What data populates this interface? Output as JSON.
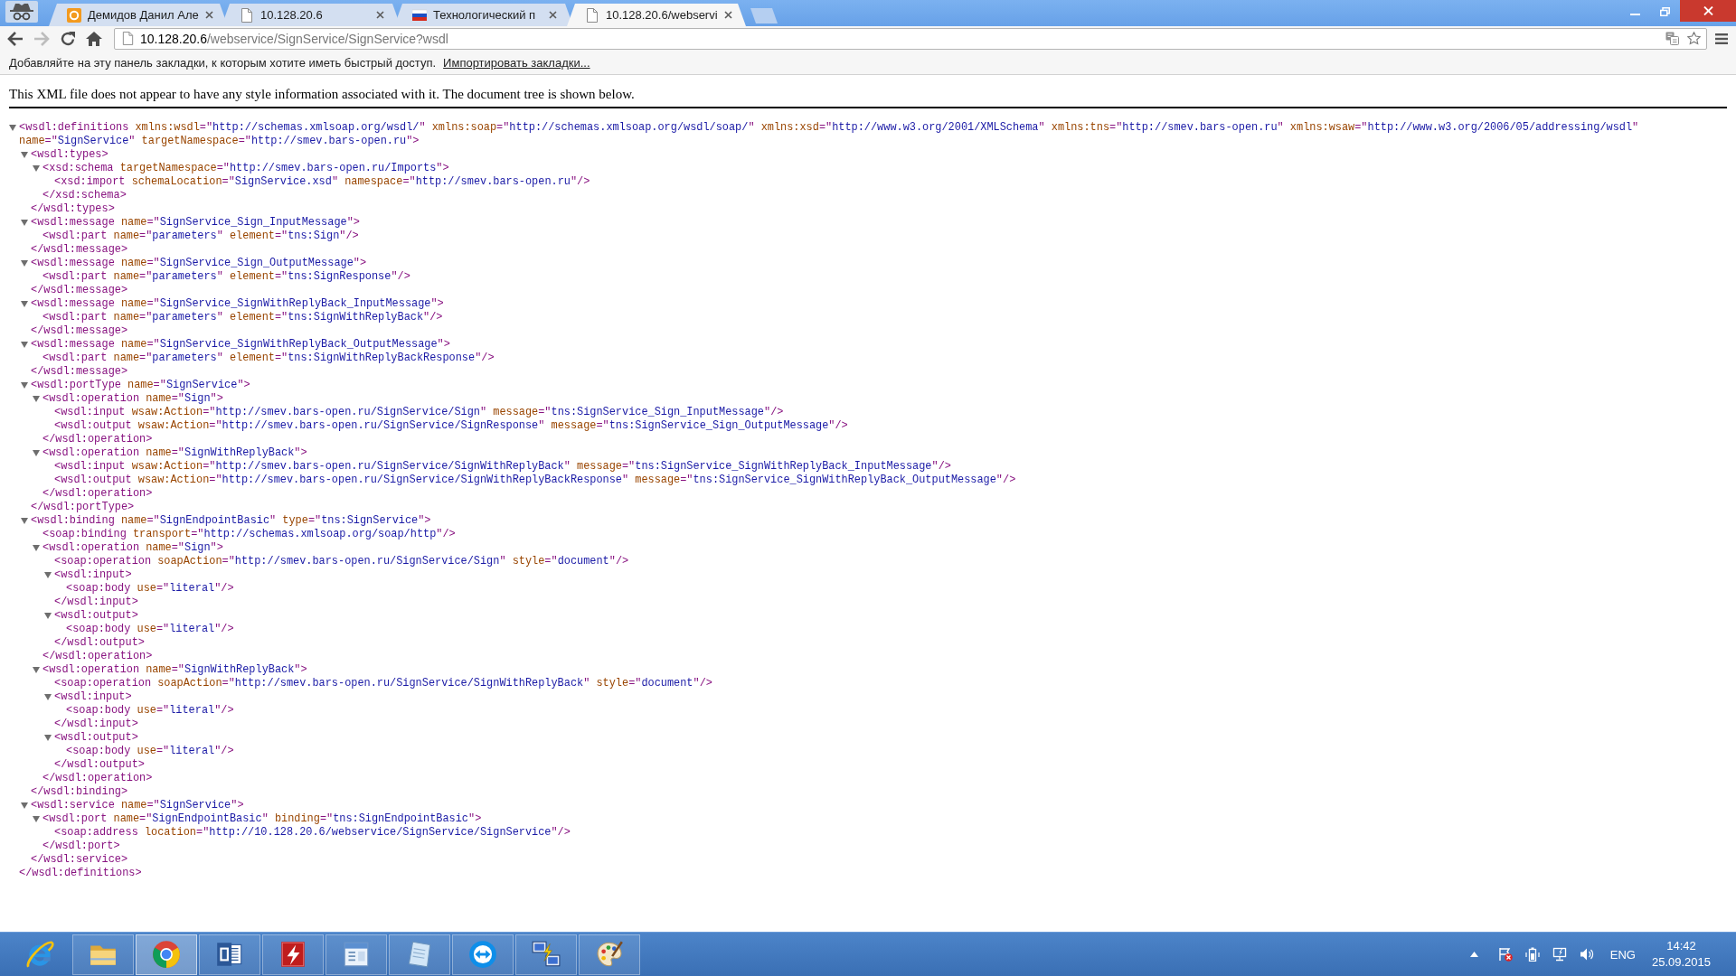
{
  "browser": {
    "tabs": [
      {
        "title": "Демидов Данил Але",
        "kind": "tile",
        "selected": false
      },
      {
        "title": "10.128.20.6",
        "kind": "page",
        "selected": false
      },
      {
        "title": "Технологический п",
        "kind": "flag",
        "selected": false
      },
      {
        "title": "10.128.20.6/webservi",
        "kind": "page",
        "selected": true
      }
    ]
  },
  "toolbar": {
    "buttons": [
      {
        "kind": "back",
        "disabled": false
      },
      {
        "kind": "forward",
        "disabled": true
      },
      {
        "kind": "reload",
        "disabled": false
      },
      {
        "kind": "home",
        "disabled": false
      }
    ],
    "address": {
      "host": "10.128.20.6",
      "path": "/webservice/SignService/SignService?wsdl"
    }
  },
  "bookmarks_bar": {
    "hint": "Добавляйте на эту панель закладки, к которым хотите иметь быстрый доступ.",
    "link": "Импортировать закладки..."
  },
  "notice": "This XML file does not appear to have any style information associated with it. The document tree is shown below.",
  "xml": {
    "tag": "<wsdl:definitions",
    "attrs": [
      "xmlns:wsdl=\"http://schemas.xmlsoap.org/wsdl/\"",
      "xmlns:soap=\"http://schemas.xmlsoap.org/wsdl/soap/\"",
      "xmlns:xsd=\"http://www.w3.org/2001/XMLSchema\"",
      "xmlns:tns=\"http://smev.bars-open.ru\"",
      "xmlns:wsaw=\"http://www.w3.org/2006/05/addressing/wsdl\"",
      "name=\"SignService\"",
      "targetNamespace=\"http://smev.bars-open.ru\""
    ],
    "end": ">",
    "expanded": true,
    "children": [
      {
        "tag": "<wsdl:types",
        "end": ">",
        "expanded": true,
        "children": [
          {
            "tag": "<xsd:schema",
            "attrs": [
              "targetNamespace=\"http://smev.bars-open.ru/Imports\""
            ],
            "end": ">",
            "expanded": true,
            "children": [
              {
                "tag": "<xsd:import",
                "attrs": [
                  "schemaLocation=\"SignService.xsd\"",
                  "namespace=\"http://smev.bars-open.ru\""
                ],
                "end": "/>"
              }
            ],
            "close": "</xsd:schema>"
          }
        ],
        "close": "</wsdl:types>"
      },
      {
        "tag": "<wsdl:message",
        "attrs": [
          "name=\"SignService_Sign_InputMessage\""
        ],
        "end": ">",
        "expanded": true,
        "children": [
          {
            "tag": "<wsdl:part",
            "attrs": [
              "name=\"parameters\"",
              "element=\"tns:Sign\""
            ],
            "end": "/>"
          }
        ],
        "close": "</wsdl:message>"
      },
      {
        "tag": "<wsdl:message",
        "attrs": [
          "name=\"SignService_Sign_OutputMessage\""
        ],
        "end": ">",
        "expanded": true,
        "children": [
          {
            "tag": "<wsdl:part",
            "attrs": [
              "name=\"parameters\"",
              "element=\"tns:SignResponse\""
            ],
            "end": "/>"
          }
        ],
        "close": "</wsdl:message>"
      },
      {
        "tag": "<wsdl:message",
        "attrs": [
          "name=\"SignService_SignWithReplyBack_InputMessage\""
        ],
        "end": ">",
        "expanded": true,
        "children": [
          {
            "tag": "<wsdl:part",
            "attrs": [
              "name=\"parameters\"",
              "element=\"tns:SignWithReplyBack\""
            ],
            "end": "/>"
          }
        ],
        "close": "</wsdl:message>"
      },
      {
        "tag": "<wsdl:message",
        "attrs": [
          "name=\"SignService_SignWithReplyBack_OutputMessage\""
        ],
        "end": ">",
        "expanded": true,
        "children": [
          {
            "tag": "<wsdl:part",
            "attrs": [
              "name=\"parameters\"",
              "element=\"tns:SignWithReplyBackResponse\""
            ],
            "end": "/>"
          }
        ],
        "close": "</wsdl:message>"
      },
      {
        "tag": "<wsdl:portType",
        "attrs": [
          "name=\"SignService\""
        ],
        "end": ">",
        "expanded": true,
        "children": [
          {
            "tag": "<wsdl:operation",
            "attrs": [
              "name=\"Sign\""
            ],
            "end": ">",
            "expanded": true,
            "children": [
              {
                "tag": "<wsdl:input",
                "attrs": [
                  "wsaw:Action=\"http://smev.bars-open.ru/SignService/Sign\"",
                  "message=\"tns:SignService_Sign_InputMessage\""
                ],
                "end": "/>"
              },
              {
                "tag": "<wsdl:output",
                "attrs": [
                  "wsaw:Action=\"http://smev.bars-open.ru/SignService/SignResponse\"",
                  "message=\"tns:SignService_Sign_OutputMessage\""
                ],
                "end": "/>"
              }
            ],
            "close": "</wsdl:operation>"
          },
          {
            "tag": "<wsdl:operation",
            "attrs": [
              "name=\"SignWithReplyBack\""
            ],
            "end": ">",
            "expanded": true,
            "children": [
              {
                "tag": "<wsdl:input",
                "attrs": [
                  "wsaw:Action=\"http://smev.bars-open.ru/SignService/SignWithReplyBack\"",
                  "message=\"tns:SignService_SignWithReplyBack_InputMessage\""
                ],
                "end": "/>"
              },
              {
                "tag": "<wsdl:output",
                "attrs": [
                  "wsaw:Action=\"http://smev.bars-open.ru/SignService/SignWithReplyBackResponse\"",
                  "message=\"tns:SignService_SignWithReplyBack_OutputMessage\""
                ],
                "end": "/>"
              }
            ],
            "close": "</wsdl:operation>"
          }
        ],
        "close": "</wsdl:portType>"
      },
      {
        "tag": "<wsdl:binding",
        "attrs": [
          "name=\"SignEndpointBasic\"",
          "type=\"tns:SignService\""
        ],
        "end": ">",
        "expanded": true,
        "children": [
          {
            "tag": "<soap:binding",
            "attrs": [
              "transport=\"http://schemas.xmlsoap.org/soap/http\""
            ],
            "end": "/>"
          },
          {
            "tag": "<wsdl:operation",
            "attrs": [
              "name=\"Sign\""
            ],
            "end": ">",
            "expanded": true,
            "children": [
              {
                "tag": "<soap:operation",
                "attrs": [
                  "soapAction=\"http://smev.bars-open.ru/SignService/Sign\"",
                  "style=\"document\""
                ],
                "end": "/>"
              },
              {
                "tag": "<wsdl:input",
                "end": ">",
                "expanded": true,
                "children": [
                  {
                    "tag": "<soap:body",
                    "attrs": [
                      "use=\"literal\""
                    ],
                    "end": "/>"
                  }
                ],
                "close": "</wsdl:input>"
              },
              {
                "tag": "<wsdl:output",
                "end": ">",
                "expanded": true,
                "children": [
                  {
                    "tag": "<soap:body",
                    "attrs": [
                      "use=\"literal\""
                    ],
                    "end": "/>"
                  }
                ],
                "close": "</wsdl:output>"
              }
            ],
            "close": "</wsdl:operation>"
          },
          {
            "tag": "<wsdl:operation",
            "attrs": [
              "name=\"SignWithReplyBack\""
            ],
            "end": ">",
            "expanded": true,
            "children": [
              {
                "tag": "<soap:operation",
                "attrs": [
                  "soapAction=\"http://smev.bars-open.ru/SignService/SignWithReplyBack\"",
                  "style=\"document\""
                ],
                "end": "/>"
              },
              {
                "tag": "<wsdl:input",
                "end": ">",
                "expanded": true,
                "children": [
                  {
                    "tag": "<soap:body",
                    "attrs": [
                      "use=\"literal\""
                    ],
                    "end": "/>"
                  }
                ],
                "close": "</wsdl:input>"
              },
              {
                "tag": "<wsdl:output",
                "end": ">",
                "expanded": true,
                "children": [
                  {
                    "tag": "<soap:body",
                    "attrs": [
                      "use=\"literal\""
                    ],
                    "end": "/>"
                  }
                ],
                "close": "</wsdl:output>"
              }
            ],
            "close": "</wsdl:operation>"
          }
        ],
        "close": "</wsdl:binding>"
      },
      {
        "tag": "<wsdl:service",
        "attrs": [
          "name=\"SignService\""
        ],
        "end": ">",
        "expanded": true,
        "children": [
          {
            "tag": "<wsdl:port",
            "attrs": [
              "name=\"SignEndpointBasic\"",
              "binding=\"tns:SignEndpointBasic\""
            ],
            "end": ">",
            "expanded": true,
            "children": [
              {
                "tag": "<soap:address",
                "attrs": [
                  "location=\"http://10.128.20.6/webservice/SignService/SignService\""
                ],
                "end": "/>"
              }
            ],
            "close": "</wsdl:port>"
          }
        ],
        "close": "</wsdl:service>"
      }
    ],
    "close": "</wsdl:definitions>"
  },
  "taskbar": {
    "apps": [
      {
        "kind": "ie",
        "running": false,
        "selected": false
      },
      {
        "kind": "folder",
        "running": true,
        "selected": false
      },
      {
        "kind": "chrome",
        "running": true,
        "selected": true
      },
      {
        "kind": "word",
        "running": true,
        "selected": false
      },
      {
        "kind": "ftp",
        "running": true,
        "selected": false
      },
      {
        "kind": "card",
        "running": true,
        "selected": false
      },
      {
        "kind": "notes",
        "running": true,
        "selected": false
      },
      {
        "kind": "remote",
        "running": true,
        "selected": false
      },
      {
        "kind": "network",
        "running": true,
        "selected": false
      },
      {
        "kind": "paint",
        "running": true,
        "selected": false
      }
    ],
    "tray": {
      "language": "ENG",
      "time": "14:42",
      "date": "25.09.2015"
    }
  }
}
